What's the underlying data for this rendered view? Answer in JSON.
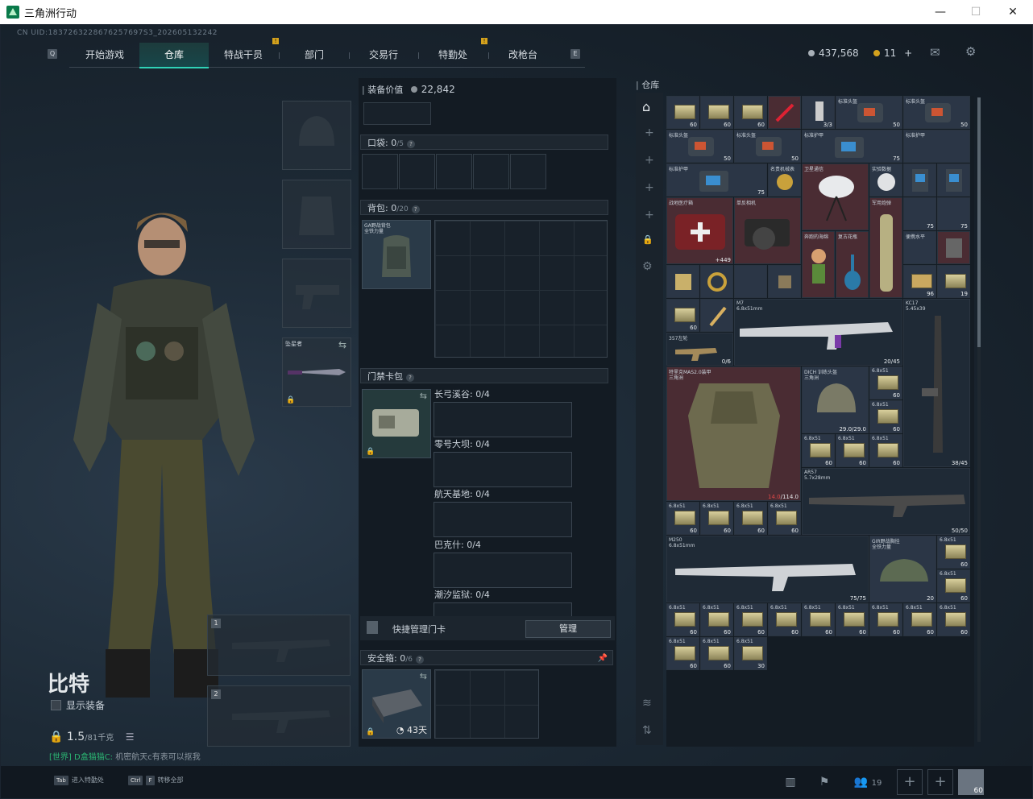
{
  "window": {
    "title": "三角洲行动",
    "minimize": "—",
    "maximize": "☐",
    "close": "✕"
  },
  "uid": "CN UID:1837263228676257697S3_202605132242",
  "nav": {
    "left_key": "Q",
    "right_key": "E",
    "tabs": [
      "开始游戏",
      "仓库",
      "特战干员",
      "部门",
      "交易行",
      "特勤处",
      "改枪台"
    ],
    "active_tab": "仓库"
  },
  "currency": {
    "coins": "437,568",
    "gold": "11",
    "plus": "+",
    "coin_color": "#a8b0b8",
    "gold_color": "#d4a21d"
  },
  "header_icons": [
    "mail-icon",
    "gear-icon"
  ],
  "character": {
    "name": "比特",
    "show_equipment": "显示装备",
    "weight_value": "1.5",
    "weight_max": "/81千克",
    "chat_channel": "[世界]",
    "chat_name": "D盒猫猫C:",
    "chat_message": "机密航天c有表可以抠我"
  },
  "equip": {
    "melee_label": "坠星者",
    "weapon_slot_1": "1",
    "weapon_slot_2": "2"
  },
  "middle": {
    "equip_value_label": "装备价值",
    "equip_value": "22,842",
    "pocket_label": "口袋:",
    "pocket_count": "0",
    "pocket_max": "/5",
    "backpack_label": "背包:",
    "backpack_count": "0",
    "backpack_max": "/20",
    "backpack_item": "GA野战背包",
    "backpack_item_sub": "全铁力量",
    "keycard_label": "门禁卡包",
    "keycard_maps": [
      "长弓溪谷: 0/4",
      "零号大坝: 0/4",
      "航天基地: 0/4",
      "巴克什: 0/4",
      "潮汐监狱: 0/4"
    ],
    "quick_manage": "快捷管理门卡",
    "manage_button": "管理",
    "safebox_label": "安全箱:",
    "safebox_count": "0",
    "safebox_max": "/6",
    "safebox_days": "43天"
  },
  "warehouse": {
    "label": "仓库",
    "items": {
      "ammo_label": "6.8x51",
      "ammo_qty": "60",
      "armor_label": "特里克MAS2.0装甲",
      "armor_sub": "三角洲",
      "armor_dura": "114.0",
      "armor_dura_cur": "14.0",
      "helmet_label": "DICH 训练头盔",
      "helmet_sub": "三角洲",
      "helmet_dura": "29.0/29.0",
      "m7_label": "M7",
      "m7_ammo": "6.8x51mm",
      "m7_qty": "20/45",
      "kc17_label": "KC17",
      "kc17_ammo": "5.45x39",
      "kc17_qty": "38/45",
      "as57_label": "AR57",
      "as57_ammo": "5.7x28mm",
      "as57_qty": "50/50",
      "m250_label": "M250",
      "m250_ammo": "6.8x51mm",
      "m250_qty": "75/75",
      "bag_label": "GIR野战胸挂",
      "bag_sub": "全铁力量",
      "bag_qty": "20",
      "revolver_label": "357左轮",
      "revolver_qty": "0/6",
      "medkit_label": "战地医疗箱",
      "medkit_qty": "+449",
      "camera_label": "单反相机",
      "gold_watch_label": "名贵机械表",
      "satellite_label": "卫星通信",
      "lab_label": "实验数据",
      "armor_plate": "标准护甲",
      "helmet_std": "标准头盔",
      "doll_label": "奔跑的海绵",
      "vase_label": "复古花瓶",
      "cannon_label": "军用炮弹",
      "level_label": "便携水平",
      "qty_3_3": "3/3",
      "qty_50": "50",
      "qty_75": "75",
      "qty_30": "30",
      "qty_19": "19",
      "qty_96": "96"
    }
  },
  "bottom": {
    "hint_tab_key": "Tab",
    "hint_tab": "进入特勤处",
    "hint_ctrl_key": "Ctrl",
    "hint_f_key": "F",
    "hint_transfer": "转移全部",
    "friends_count": "19",
    "avatar_level": "60"
  }
}
